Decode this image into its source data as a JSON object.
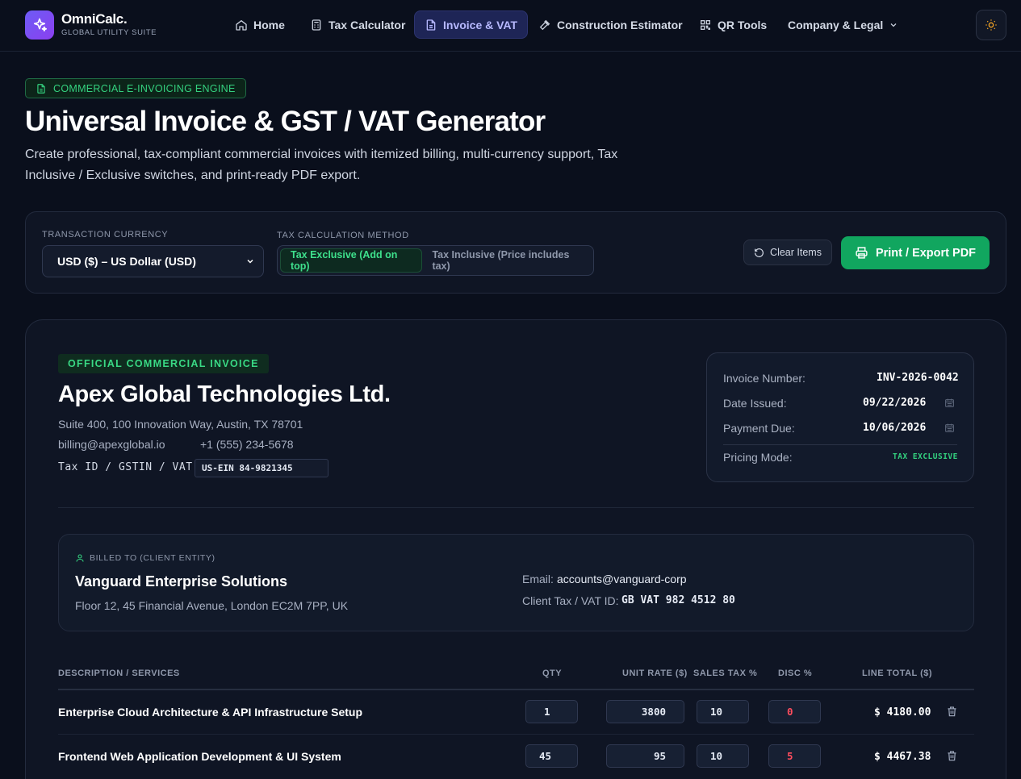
{
  "nav": {
    "brand": "OmniCalc.",
    "brand_sub": "GLOBAL UTILITY SUITE",
    "items": [
      {
        "label": "Home",
        "icon": "home-icon"
      },
      {
        "label": "Tax Calculator",
        "icon": "calculator-icon"
      },
      {
        "label": "Invoice & VAT",
        "icon": "file-text-icon",
        "active": true
      },
      {
        "label": "Construction Estimator",
        "icon": "hammer-icon"
      },
      {
        "label": "QR Tools",
        "icon": "qr-code-icon"
      },
      {
        "label": "Company & Legal",
        "icon": "chevron-down-icon"
      }
    ],
    "theme_icon": "sun-icon"
  },
  "hero": {
    "badge": "COMMERCIAL E-INVOICING ENGINE",
    "title": "Universal Invoice & GST / VAT Generator",
    "description": "Create professional, tax-compliant commercial invoices with itemized billing, multi-currency support, Tax Inclusive / Exclusive switches, and print-ready PDF export."
  },
  "controls": {
    "currency_label": "TRANSACTION CURRENCY",
    "currency_value": "USD ($) – US Dollar (USD)",
    "method_label": "TAX CALCULATION METHOD",
    "method_options": [
      "Tax Exclusive (Add on top)",
      "Tax Inclusive (Price includes tax)"
    ],
    "method_selected": 0,
    "clear_label": "Clear Items",
    "print_label": "Print / Export PDF"
  },
  "invoice": {
    "badge": "OFFICIAL COMMERCIAL INVOICE",
    "company": "Apex Global Technologies Ltd.",
    "address": "Suite 400, 100 Innovation Way, Austin, TX 78701",
    "email": "billing@apexglobal.io",
    "phone": "+1 (555) 234-5678",
    "tax_id_label": "Tax ID / GSTIN / VAT:",
    "tax_id_value": "US-EIN 84-9821345",
    "meta": {
      "number_label": "Invoice Number:",
      "number_value": "INV-2026-0042",
      "issued_label": "Date Issued:",
      "issued_value": "09/22/2026",
      "due_label": "Payment Due:",
      "due_value": "10/06/2026",
      "pricing_label": "Pricing Mode:",
      "pricing_value": "TAX EXCLUSIVE"
    },
    "client": {
      "tag": "BILLED TO (CLIENT ENTITY)",
      "name": "Vanguard Enterprise Solutions",
      "address": "Floor 12, 45 Financial Avenue, London EC2M 7PP, UK",
      "email_label": "Email:",
      "email_value": "accounts@vanguard-corp",
      "vat_label": "Client Tax / VAT ID:",
      "vat_value": "GB VAT 982 4512 80"
    },
    "table": {
      "headers": [
        "DESCRIPTION / SERVICES",
        "QTY",
        "UNIT RATE ($)",
        "SALES TAX %",
        "DISC %",
        "LINE TOTAL ($)"
      ],
      "rows": [
        {
          "description": "Enterprise Cloud Architecture & API Infrastructure Setup",
          "qty": "1",
          "rate": "3800",
          "tax": "10",
          "disc": "0",
          "total": "$ 4180.00"
        },
        {
          "description": "Frontend Web Application Development & UI System",
          "qty": "45",
          "rate": "95",
          "tax": "10",
          "disc": "5",
          "total": "$ 4467.38"
        }
      ]
    }
  },
  "colors": {
    "background": "#0a0f1c",
    "accent_green": "#11a65f",
    "accent_purple": "#6d5cf5",
    "discount_red": "#ff4d5e"
  }
}
